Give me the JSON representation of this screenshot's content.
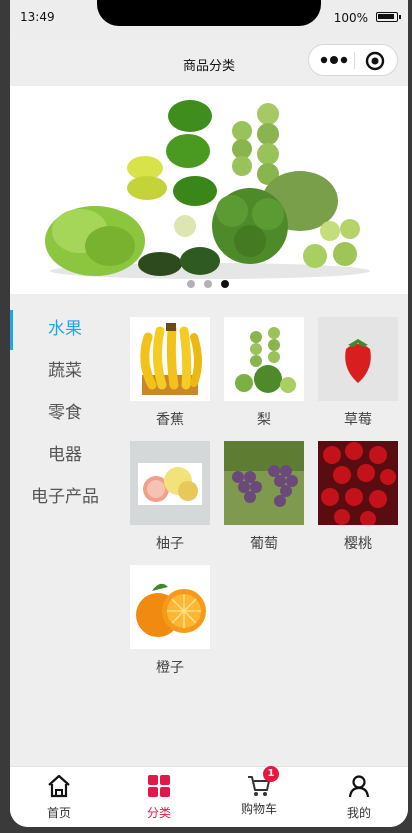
{
  "status_bar": {
    "time": "13:49",
    "battery": "100%"
  },
  "nav": {
    "title": "商品分类"
  },
  "banner": {
    "slide_count": 3,
    "active_slide": 3
  },
  "sidebar": {
    "items": [
      {
        "label": "水果",
        "active": true
      },
      {
        "label": "蔬菜",
        "active": false
      },
      {
        "label": "零食",
        "active": false
      },
      {
        "label": "电器",
        "active": false
      },
      {
        "label": "电子产品",
        "active": false
      }
    ]
  },
  "products": [
    {
      "name": "香蕉"
    },
    {
      "name": "梨"
    },
    {
      "name": "草莓"
    },
    {
      "name": "柚子"
    },
    {
      "name": "葡萄"
    },
    {
      "name": "樱桃"
    },
    {
      "name": "橙子"
    }
  ],
  "tab_bar": {
    "tabs": [
      {
        "label": "首页",
        "icon": "home-icon"
      },
      {
        "label": "分类",
        "icon": "category-icon",
        "active": true
      },
      {
        "label": "购物车",
        "icon": "cart-icon",
        "badge": "1"
      },
      {
        "label": "我的",
        "icon": "user-icon"
      }
    ]
  },
  "colors": {
    "accent": "#1aa7ec",
    "tab_active": "#e0194a",
    "badge": "#e8163c"
  }
}
